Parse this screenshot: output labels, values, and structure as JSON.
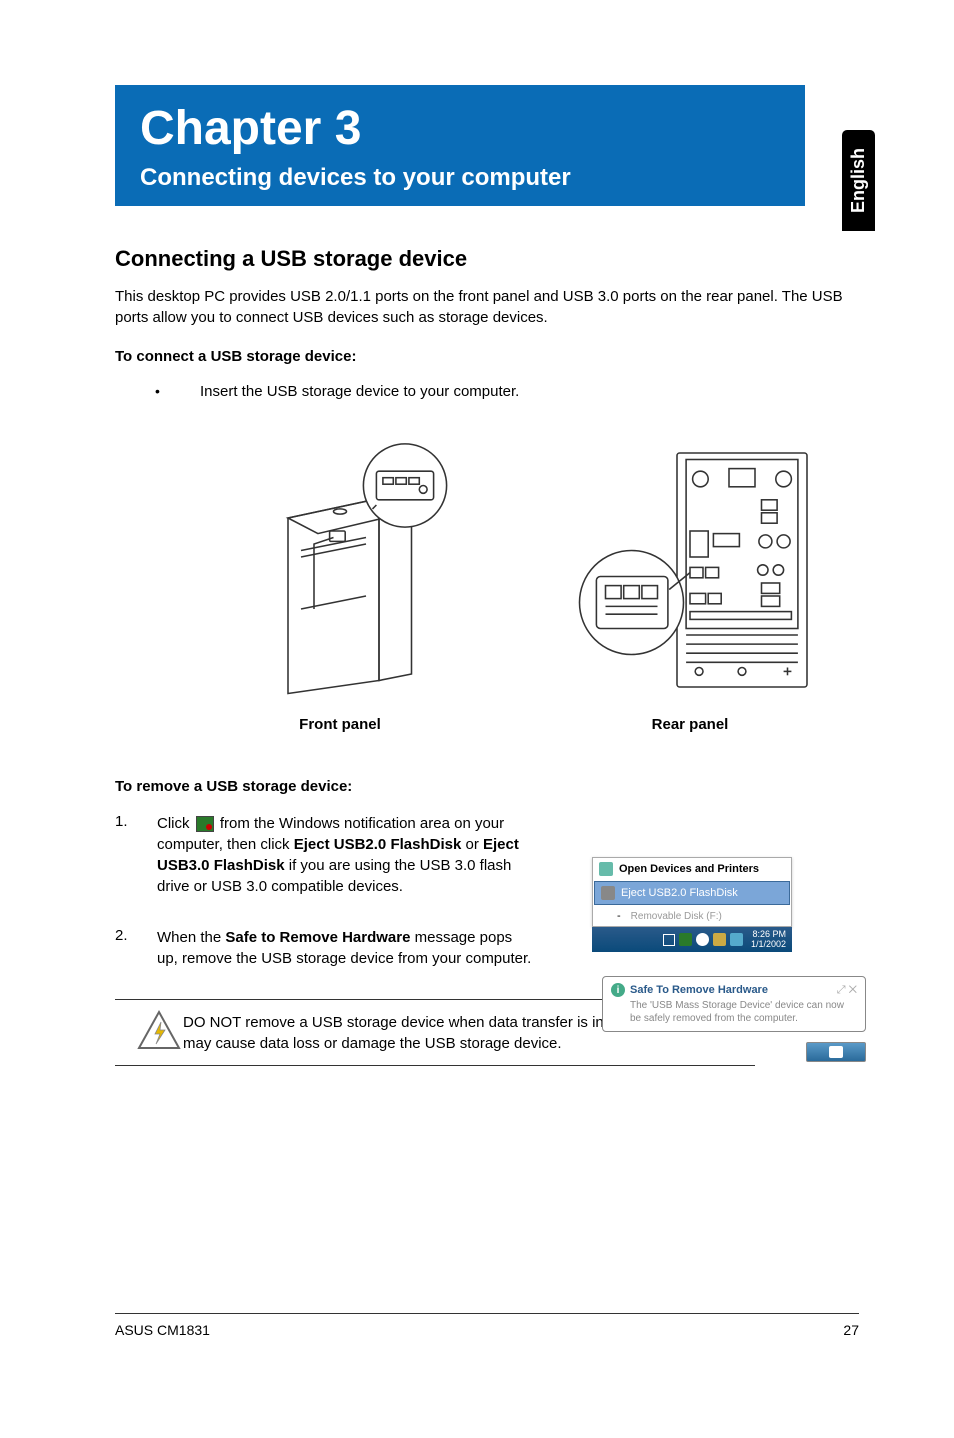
{
  "language_tab": "English",
  "chapter": {
    "title": "Chapter 3",
    "subtitle": "Connecting devices to your computer"
  },
  "section1": {
    "title": "Connecting a USB storage device",
    "intro": "This desktop PC provides USB 2.0/1.1 ports on the front panel and USB 3.0 ports on the rear panel. The USB ports allow you to connect USB devices such as storage devices.",
    "connect_heading": "To connect a USB storage device:",
    "connect_bullet": "Insert the USB storage device to your computer.",
    "front_caption": "Front panel",
    "rear_caption": "Rear panel",
    "remove_heading": "To remove a USB storage device:"
  },
  "steps": {
    "s1_num": "1.",
    "s1_a": "Click ",
    "s1_b": " from the Windows notification area on your computer, then click ",
    "s1_bold1": "Eject USB2.0 FlashDisk",
    "s1_c": " or ",
    "s1_bold2": "Eject USB3.0 FlashDisk",
    "s1_d": " if you are using the USB 3.0 flash drive or USB 3.0 compatible devices.",
    "s2_num": "2.",
    "s2_a": "When the ",
    "s2_bold": "Safe to Remove Hardware",
    "s2_b": " message pops up, remove the USB storage device from your computer."
  },
  "tray": {
    "open": "Open Devices and Printers",
    "eject": "Eject USB2.0 FlashDisk",
    "removable": "Removable Disk (F:)",
    "time1": "8:26 PM",
    "date1": "1/1/2002"
  },
  "balloon": {
    "title": "Safe To Remove Hardware",
    "body": "The 'USB Mass Storage Device' device can now be safely removed from the computer."
  },
  "warning": "DO NOT remove a USB storage device when data transfer is in progress. Doing so may cause data loss or damage the USB storage device.",
  "footer": {
    "left": "ASUS CM1831",
    "right": "27"
  }
}
